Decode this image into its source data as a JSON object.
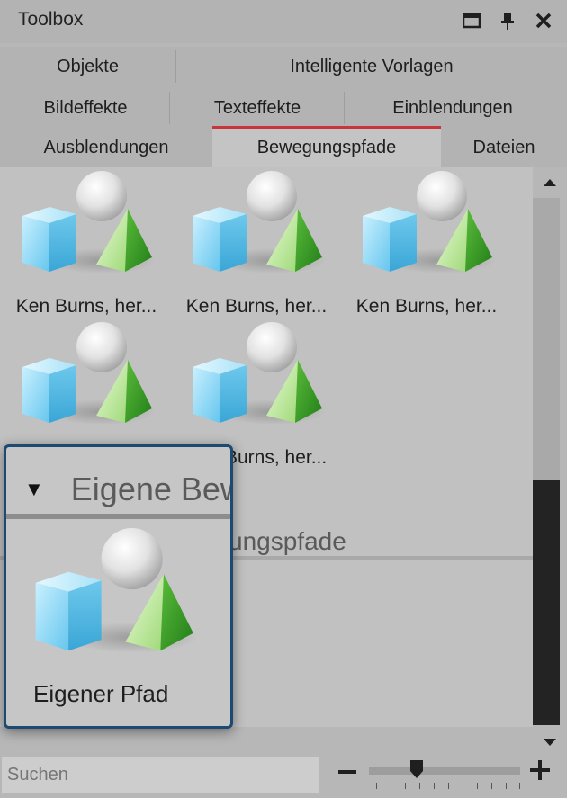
{
  "window": {
    "title": "Toolbox"
  },
  "tabs": {
    "row1": [
      "Objekte",
      "Intelligente Vorlagen"
    ],
    "row2": [
      "Bildeffekte",
      "Texteffekte",
      "Einblendungen"
    ],
    "row3": [
      "Ausblendungen",
      "Bewegungspfade",
      "Dateien"
    ],
    "active": "Bewegungspfade"
  },
  "items": [
    {
      "label": "Ken Burns, her..."
    },
    {
      "label": "Ken Burns, her..."
    },
    {
      "label": "Ken Burns, her..."
    },
    {
      "label": ""
    },
    {
      "label": "Ken Burns, her..."
    }
  ],
  "group_partial": "ungspfade",
  "popup": {
    "header": "Eigene Bewegungspfade",
    "item_label": "Eigener Pfad"
  },
  "search": {
    "placeholder": "Suchen"
  },
  "colors": {
    "accent": "#c8353b",
    "popup_border": "#1c4a73"
  }
}
